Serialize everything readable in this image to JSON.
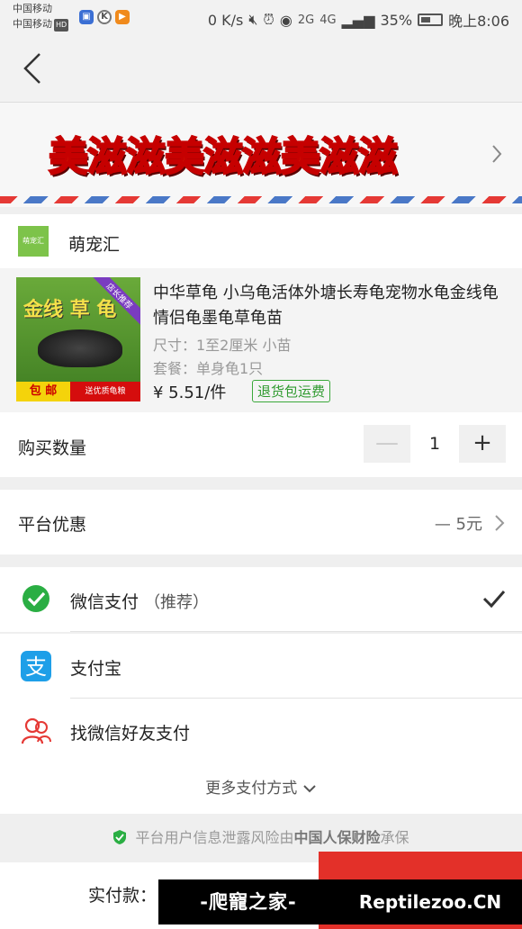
{
  "status_bar": {
    "carrier1": "中国移动",
    "carrier2": "中国移动",
    "hd_badge": "HD",
    "speed": "0 K/s",
    "net1": "2G",
    "net2": "4G",
    "battery": "35%",
    "time": "晚上8:06",
    "icons": [
      "mute-icon",
      "alarm-icon",
      "eye-icon",
      "signal-icon",
      "battery-icon"
    ]
  },
  "banner": {
    "text": "美滋滋美滋滋美滋滋"
  },
  "shop": {
    "logo_text": "萌宠汇",
    "name": "萌宠汇"
  },
  "product": {
    "title": "中华草龟 小乌龟活体外塘长寿龟宠物水龟金线龟情侣龟墨龟草龟苗",
    "size": "尺寸：1至2厘米 小苗",
    "package": "套餐：单身龟1只",
    "price": "¥ 5.51/件",
    "tag": "退货包运费",
    "image_text": "金线 草 龟",
    "image_ribbon": "店长推荐",
    "image_bar_left": "包 邮",
    "image_bar_right": "送优质龟粮"
  },
  "quantity": {
    "label": "购买数量",
    "minus": "—",
    "value": "1",
    "plus": "+"
  },
  "discount": {
    "label": "平台优惠",
    "value": "— 5元"
  },
  "payment": {
    "wechat_label": "微信支付",
    "wechat_note": "（推荐）",
    "alipay_label": "支付宝",
    "friend_label": "找微信好友支付",
    "more_label": "更多支付方式"
  },
  "insurance": {
    "prefix": "平台用户信息泄露风险由",
    "brand": "中国人保财险",
    "suffix": "承保"
  },
  "bottom": {
    "total_label": "实付款："
  },
  "watermark": {
    "left": "-爬寵之家-",
    "right": "Reptilezoo.CN"
  },
  "colors": {
    "accent": "#e33029",
    "wechat": "#2aae43",
    "alipay": "#1e9fe8",
    "tag_green": "#2f9a2f"
  }
}
